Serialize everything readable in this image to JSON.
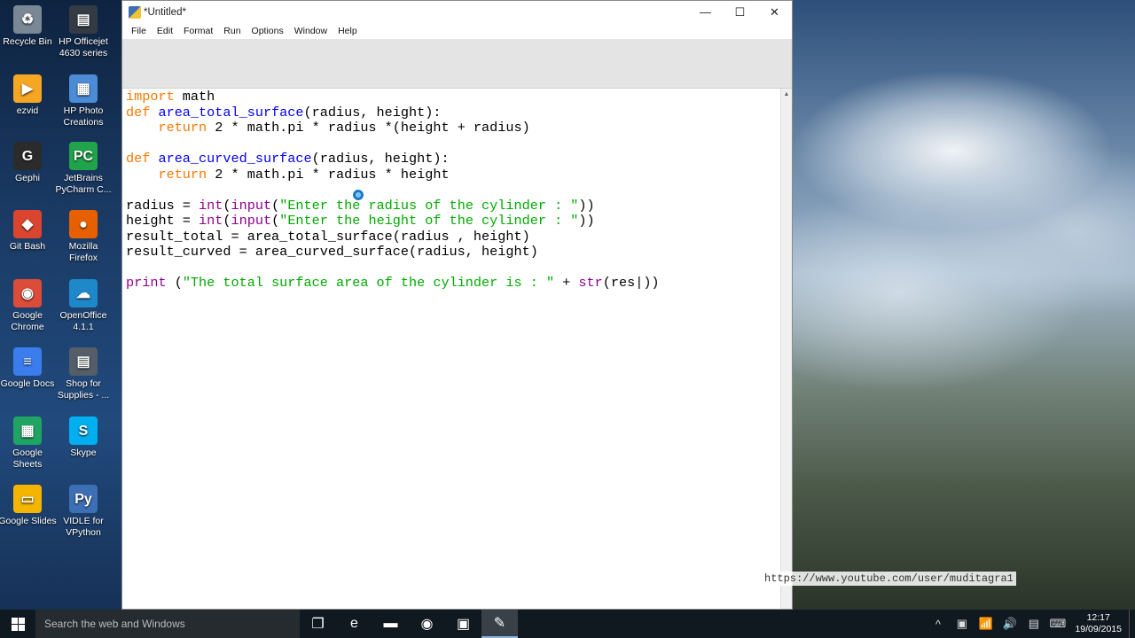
{
  "desktop": {
    "icons": [
      {
        "label": "Recycle Bin",
        "name": "recycle-bin-icon",
        "color": "#7a8896",
        "glyph": "♻"
      },
      {
        "label": "HP Officejet 4630 series",
        "name": "printer-icon",
        "color": "#333b44",
        "glyph": "▤"
      },
      {
        "label": "ezvid",
        "name": "ezvid-icon",
        "color": "#f5a623",
        "glyph": "▶"
      },
      {
        "label": "HP Photo Creations",
        "name": "hp-photo-icon",
        "color": "#4c8bd6",
        "glyph": "▦"
      },
      {
        "label": "Gephi",
        "name": "gephi-icon",
        "color": "#2b2b2b",
        "glyph": "G"
      },
      {
        "label": "JetBrains PyCharm C...",
        "name": "pycharm-icon",
        "color": "#20a34a",
        "glyph": "PC"
      },
      {
        "label": "Git Bash",
        "name": "git-bash-icon",
        "color": "#d9452e",
        "glyph": "◆"
      },
      {
        "label": "Mozilla Firefox",
        "name": "firefox-icon",
        "color": "#e66000",
        "glyph": "●"
      },
      {
        "label": "Google Chrome",
        "name": "chrome-icon",
        "color": "#dd4b39",
        "glyph": "◉"
      },
      {
        "label": "OpenOffice 4.1.1",
        "name": "openoffice-icon",
        "color": "#1e88c9",
        "glyph": "☁"
      },
      {
        "label": "Google Docs",
        "name": "google-docs-icon",
        "color": "#3b7ded",
        "glyph": "≡"
      },
      {
        "label": "Shop for Supplies - ...",
        "name": "shop-supplies-icon",
        "color": "#555e68",
        "glyph": "▤"
      },
      {
        "label": "Google Sheets",
        "name": "google-sheets-icon",
        "color": "#1fa463",
        "glyph": "▦"
      },
      {
        "label": "Skype",
        "name": "skype-icon",
        "color": "#00aff0",
        "glyph": "S"
      },
      {
        "label": "Google Slides",
        "name": "google-slides-icon",
        "color": "#f4b400",
        "glyph": "▭"
      },
      {
        "label": "VIDLE for VPython",
        "name": "vidle-icon",
        "color": "#3d6fb5",
        "glyph": "Py"
      }
    ]
  },
  "window": {
    "title": "*Untitled*",
    "controls": {
      "minimize": "—",
      "maximize": "☐",
      "close": "✕"
    },
    "menu": [
      "File",
      "Edit",
      "Format",
      "Run",
      "Options",
      "Window",
      "Help"
    ]
  },
  "editor": {
    "lines": [
      [
        {
          "t": "import",
          "c": "kw"
        },
        {
          "t": " math"
        }
      ],
      [
        {
          "t": "def",
          "c": "kw"
        },
        {
          "t": " "
        },
        {
          "t": "area_total_surface",
          "c": "fn"
        },
        {
          "t": "(radius, height):"
        }
      ],
      [
        {
          "t": "    "
        },
        {
          "t": "return",
          "c": "kw"
        },
        {
          "t": " 2 * math.pi * radius *(height + radius)"
        }
      ],
      [
        {
          "t": ""
        }
      ],
      [
        {
          "t": "def",
          "c": "kw"
        },
        {
          "t": " "
        },
        {
          "t": "area_curved_surface",
          "c": "fn"
        },
        {
          "t": "(radius, height):"
        }
      ],
      [
        {
          "t": "    "
        },
        {
          "t": "return",
          "c": "kw"
        },
        {
          "t": " 2 * math.pi * radius * height"
        }
      ],
      [
        {
          "t": ""
        }
      ],
      [
        {
          "t": "radius = "
        },
        {
          "t": "int",
          "c": "bi"
        },
        {
          "t": "("
        },
        {
          "t": "input",
          "c": "bi"
        },
        {
          "t": "("
        },
        {
          "t": "\"Enter the radius of the cylinder : \"",
          "c": "str"
        },
        {
          "t": "))"
        }
      ],
      [
        {
          "t": "height = "
        },
        {
          "t": "int",
          "c": "bi"
        },
        {
          "t": "("
        },
        {
          "t": "input",
          "c": "bi"
        },
        {
          "t": "("
        },
        {
          "t": "\"Enter the height of the cylinder : \"",
          "c": "str"
        },
        {
          "t": "))"
        }
      ],
      [
        {
          "t": "result_total = area_total_surface(radius , height)"
        }
      ],
      [
        {
          "t": "result_curved = area_curved_surface(radius, height)"
        }
      ],
      [
        {
          "t": ""
        }
      ],
      [
        {
          "t": "print",
          "c": "bi"
        },
        {
          "t": " ("
        },
        {
          "t": "\"The total surface area of the cylinder is : \"",
          "c": "str"
        },
        {
          "t": " + "
        },
        {
          "t": "str",
          "c": "bi"
        },
        {
          "t": "(res|))"
        }
      ]
    ]
  },
  "watermark": "https://www.youtube.com/user/muditagra1",
  "taskbar": {
    "search_placeholder": "Search the web and Windows",
    "pinned": [
      {
        "name": "task-view-icon",
        "glyph": "❐",
        "active": false
      },
      {
        "name": "edge-icon",
        "glyph": "e",
        "active": false
      },
      {
        "name": "file-explorer-icon",
        "glyph": "▬",
        "active": false
      },
      {
        "name": "chrome-taskbar-icon",
        "glyph": "◉",
        "active": false
      },
      {
        "name": "media-app-icon",
        "glyph": "▣",
        "active": false
      },
      {
        "name": "idle-taskbar-icon",
        "glyph": "✎",
        "active": true
      }
    ],
    "tray": [
      {
        "name": "show-hidden-icon",
        "glyph": "^"
      },
      {
        "name": "app-tray-icon",
        "glyph": "▣"
      },
      {
        "name": "network-icon",
        "glyph": "📶"
      },
      {
        "name": "volume-icon",
        "glyph": "🔊"
      },
      {
        "name": "action-center-icon",
        "glyph": "▤"
      },
      {
        "name": "keyboard-icon",
        "glyph": "⌨"
      }
    ],
    "time": "12:17",
    "date": "19/09/2015"
  }
}
